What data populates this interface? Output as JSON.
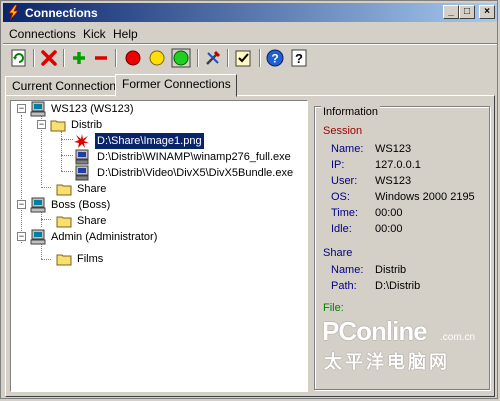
{
  "window": {
    "title": "Connections"
  },
  "menu": {
    "connections": "Connections",
    "kick": "Kick",
    "help": "Help"
  },
  "toolbar": {
    "tools": [
      {
        "icon": "refresh-icon"
      },
      {
        "icon": "delete-x-icon"
      },
      {
        "icon": "add-icon"
      },
      {
        "icon": "remove-icon"
      },
      {
        "icon": "red-light-icon"
      },
      {
        "icon": "yellow-light-icon"
      },
      {
        "icon": "green-light-icon"
      },
      {
        "icon": "tools-icon"
      },
      {
        "icon": "checklist-icon"
      },
      {
        "icon": "help-icon"
      },
      {
        "icon": "context-help-icon"
      }
    ]
  },
  "tabs": {
    "current": "Current Connections",
    "former": "Former Connections"
  },
  "tree": {
    "ws123": "WS123 (WS123)",
    "distrib": "Distrib",
    "file1": "D:\\Share\\Image1.png",
    "file2": "D:\\Distrib\\WINAMP\\winamp276_full.exe",
    "file3": "D:\\Distrib\\Video\\DivX5\\DivX5Bundle.exe",
    "share1": "Share",
    "boss": "Boss (Boss)",
    "share2": "Share",
    "admin": "Admin (Administrator)",
    "films": "Films"
  },
  "info": {
    "title": "Information",
    "session_label": "Session",
    "name_k": "Name:",
    "name_v": "WS123",
    "ip_k": "IP:",
    "ip_v": "127.0.0.1",
    "user_k": "User:",
    "user_v": "WS123",
    "os_k": "OS:",
    "os_v": "Windows 2000 2195",
    "time_k": "Time:",
    "time_v": "00:00",
    "idle_k": "Idle:",
    "idle_v": "00:00",
    "share_label": "Share",
    "sname_k": "Name:",
    "sname_v": "Distrib",
    "path_k": "Path:",
    "path_v": "D:\\Distrib",
    "file_label": "File:"
  },
  "watermark": {
    "main": "PConline",
    "domain": ".com.cn",
    "cn": "太平洋电脑网"
  },
  "colors": {
    "title_start": "#0a246a",
    "title_end": "#a6caf0",
    "section": "#a00000",
    "key": "#000080",
    "file_label": "#008000",
    "selection": "#0a246a"
  }
}
